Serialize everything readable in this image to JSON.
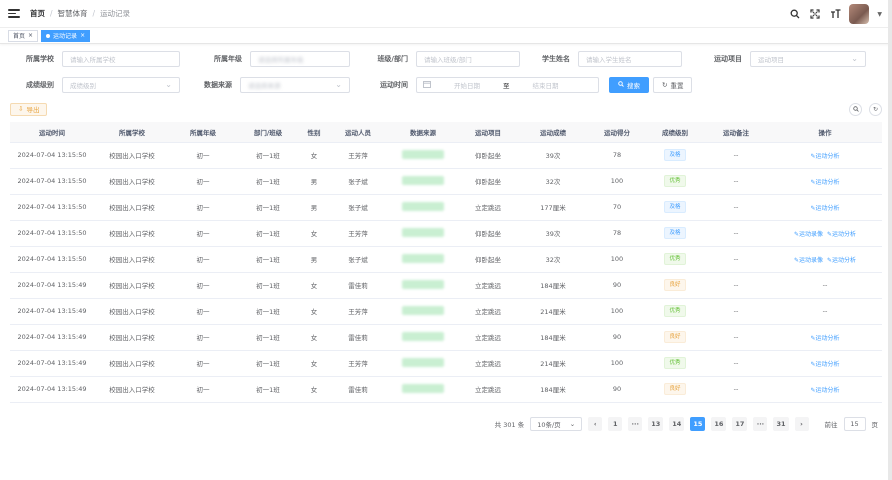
{
  "breadcrumb": {
    "home": "首页",
    "mid": "智慧体育",
    "current": "运动记录"
  },
  "tags": [
    {
      "label": "首页"
    },
    {
      "label": "运动记录"
    }
  ],
  "form": {
    "school": {
      "label": "所属学校",
      "placeholder": "请输入所属学校"
    },
    "grade": {
      "label": "所属年级",
      "placeholder": "请选择所属年级"
    },
    "class": {
      "label": "班级/部门",
      "placeholder": "请输入班级/部门"
    },
    "student": {
      "label": "学生姓名",
      "placeholder": "请输入学生姓名"
    },
    "item": {
      "label": "运动项目",
      "placeholder": "运动项目"
    },
    "level": {
      "label": "成绩级别",
      "placeholder": "成绩级别"
    },
    "source": {
      "label": "数据来源",
      "placeholder": "请选择来源"
    },
    "time": {
      "label": "运动时间",
      "start": "开始日期",
      "to": "至",
      "end": "结束日期"
    },
    "search": "搜索",
    "reset": "重置"
  },
  "toolbar": {
    "export": "导出"
  },
  "columns": [
    "运动时间",
    "所属学校",
    "所属年级",
    "部门/班级",
    "性别",
    "运动人员",
    "数据来源",
    "运动项目",
    "运动成绩",
    "运动得分",
    "成绩级别",
    "运动备注",
    "操作"
  ],
  "rows": [
    {
      "time": "2024-07-04 13:15:50",
      "school": "校园出入口学校",
      "grade": "初一",
      "class": "初一1班",
      "sex": "女",
      "name": "王芳萍",
      "item": "仰卧起坐",
      "result": "39次",
      "score": "78",
      "level": "及格",
      "lv": "pass",
      "note": "--",
      "ops": [
        "运动分析"
      ]
    },
    {
      "time": "2024-07-04 13:15:50",
      "school": "校园出入口学校",
      "grade": "初一",
      "class": "初一1班",
      "sex": "男",
      "name": "张子斌",
      "item": "仰卧起坐",
      "result": "32次",
      "score": "100",
      "level": "优秀",
      "lv": "excel",
      "note": "--",
      "ops": [
        "运动分析"
      ]
    },
    {
      "time": "2024-07-04 13:15:50",
      "school": "校园出入口学校",
      "grade": "初一",
      "class": "初一1班",
      "sex": "男",
      "name": "张子斌",
      "item": "立定跳远",
      "result": "177厘米",
      "score": "70",
      "level": "及格",
      "lv": "pass",
      "note": "--",
      "ops": [
        "运动分析"
      ]
    },
    {
      "time": "2024-07-04 13:15:50",
      "school": "校园出入口学校",
      "grade": "初一",
      "class": "初一1班",
      "sex": "女",
      "name": "王芳萍",
      "item": "仰卧起坐",
      "result": "39次",
      "score": "78",
      "level": "及格",
      "lv": "pass",
      "note": "--",
      "ops": [
        "运动录像",
        "运动分析"
      ]
    },
    {
      "time": "2024-07-04 13:15:50",
      "school": "校园出入口学校",
      "grade": "初一",
      "class": "初一1班",
      "sex": "男",
      "name": "张子斌",
      "item": "仰卧起坐",
      "result": "32次",
      "score": "100",
      "level": "优秀",
      "lv": "excel",
      "note": "--",
      "ops": [
        "运动录像",
        "运动分析"
      ]
    },
    {
      "time": "2024-07-04 13:15:49",
      "school": "校园出入口学校",
      "grade": "初一",
      "class": "初一1班",
      "sex": "女",
      "name": "雷佳莉",
      "item": "立定跳远",
      "result": "184厘米",
      "score": "90",
      "level": "良好",
      "lv": "good",
      "note": "--",
      "ops": [
        "--"
      ]
    },
    {
      "time": "2024-07-04 13:15:49",
      "school": "校园出入口学校",
      "grade": "初一",
      "class": "初一1班",
      "sex": "女",
      "name": "王芳萍",
      "item": "立定跳远",
      "result": "214厘米",
      "score": "100",
      "level": "优秀",
      "lv": "excel",
      "note": "--",
      "ops": [
        "--"
      ]
    },
    {
      "time": "2024-07-04 13:15:49",
      "school": "校园出入口学校",
      "grade": "初一",
      "class": "初一1班",
      "sex": "女",
      "name": "雷佳莉",
      "item": "立定跳远",
      "result": "184厘米",
      "score": "90",
      "level": "良好",
      "lv": "good",
      "note": "--",
      "ops": [
        "运动分析"
      ]
    },
    {
      "time": "2024-07-04 13:15:49",
      "school": "校园出入口学校",
      "grade": "初一",
      "class": "初一1班",
      "sex": "女",
      "name": "王芳萍",
      "item": "立定跳远",
      "result": "214厘米",
      "score": "100",
      "level": "优秀",
      "lv": "excel",
      "note": "--",
      "ops": [
        "运动分析"
      ]
    },
    {
      "time": "2024-07-04 13:15:49",
      "school": "校园出入口学校",
      "grade": "初一",
      "class": "初一1班",
      "sex": "女",
      "name": "雷佳莉",
      "item": "立定跳远",
      "result": "184厘米",
      "score": "90",
      "level": "良好",
      "lv": "good",
      "note": "--",
      "ops": [
        "运动分析"
      ]
    }
  ],
  "pagination": {
    "total": "共 301 条",
    "size": "10条/页",
    "pages": [
      "1",
      "···",
      "13",
      "14",
      "15",
      "16",
      "17",
      "···",
      "31"
    ],
    "current": "15",
    "goto": "前往",
    "goto_value": "15",
    "page_unit": "页"
  },
  "colors": {
    "primary": "#409eff",
    "pass": "#409eff",
    "excellent": "#67c23a",
    "good": "#e6a23c"
  }
}
